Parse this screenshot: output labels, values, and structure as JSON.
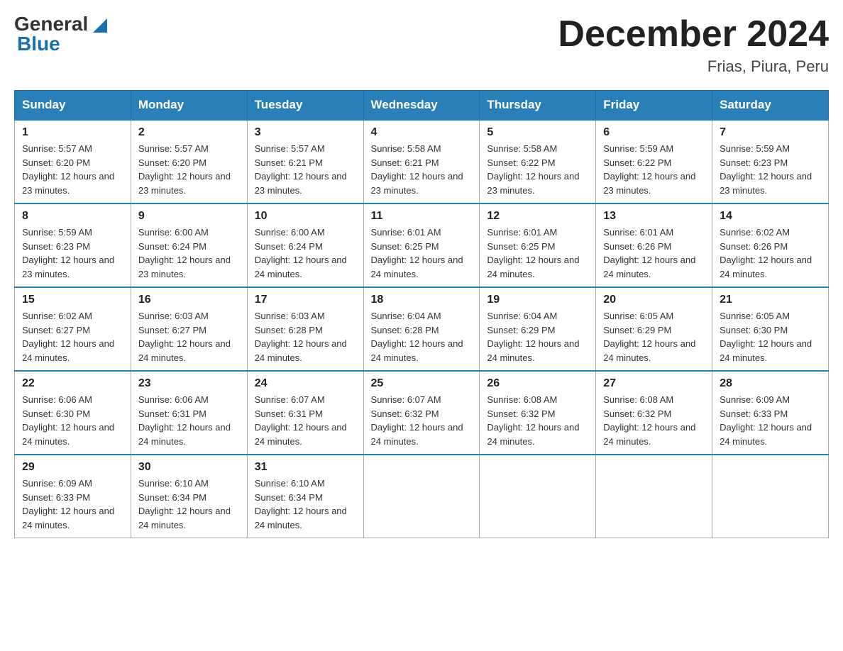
{
  "header": {
    "logo_general": "General",
    "logo_blue": "Blue",
    "month_title": "December 2024",
    "subtitle": "Frias, Piura, Peru"
  },
  "days_of_week": [
    "Sunday",
    "Monday",
    "Tuesday",
    "Wednesday",
    "Thursday",
    "Friday",
    "Saturday"
  ],
  "weeks": [
    [
      {
        "day": "1",
        "sunrise": "5:57 AM",
        "sunset": "6:20 PM",
        "daylight": "12 hours and 23 minutes."
      },
      {
        "day": "2",
        "sunrise": "5:57 AM",
        "sunset": "6:20 PM",
        "daylight": "12 hours and 23 minutes."
      },
      {
        "day": "3",
        "sunrise": "5:57 AM",
        "sunset": "6:21 PM",
        "daylight": "12 hours and 23 minutes."
      },
      {
        "day": "4",
        "sunrise": "5:58 AM",
        "sunset": "6:21 PM",
        "daylight": "12 hours and 23 minutes."
      },
      {
        "day": "5",
        "sunrise": "5:58 AM",
        "sunset": "6:22 PM",
        "daylight": "12 hours and 23 minutes."
      },
      {
        "day": "6",
        "sunrise": "5:59 AM",
        "sunset": "6:22 PM",
        "daylight": "12 hours and 23 minutes."
      },
      {
        "day": "7",
        "sunrise": "5:59 AM",
        "sunset": "6:23 PM",
        "daylight": "12 hours and 23 minutes."
      }
    ],
    [
      {
        "day": "8",
        "sunrise": "5:59 AM",
        "sunset": "6:23 PM",
        "daylight": "12 hours and 23 minutes."
      },
      {
        "day": "9",
        "sunrise": "6:00 AM",
        "sunset": "6:24 PM",
        "daylight": "12 hours and 23 minutes."
      },
      {
        "day": "10",
        "sunrise": "6:00 AM",
        "sunset": "6:24 PM",
        "daylight": "12 hours and 24 minutes."
      },
      {
        "day": "11",
        "sunrise": "6:01 AM",
        "sunset": "6:25 PM",
        "daylight": "12 hours and 24 minutes."
      },
      {
        "day": "12",
        "sunrise": "6:01 AM",
        "sunset": "6:25 PM",
        "daylight": "12 hours and 24 minutes."
      },
      {
        "day": "13",
        "sunrise": "6:01 AM",
        "sunset": "6:26 PM",
        "daylight": "12 hours and 24 minutes."
      },
      {
        "day": "14",
        "sunrise": "6:02 AM",
        "sunset": "6:26 PM",
        "daylight": "12 hours and 24 minutes."
      }
    ],
    [
      {
        "day": "15",
        "sunrise": "6:02 AM",
        "sunset": "6:27 PM",
        "daylight": "12 hours and 24 minutes."
      },
      {
        "day": "16",
        "sunrise": "6:03 AM",
        "sunset": "6:27 PM",
        "daylight": "12 hours and 24 minutes."
      },
      {
        "day": "17",
        "sunrise": "6:03 AM",
        "sunset": "6:28 PM",
        "daylight": "12 hours and 24 minutes."
      },
      {
        "day": "18",
        "sunrise": "6:04 AM",
        "sunset": "6:28 PM",
        "daylight": "12 hours and 24 minutes."
      },
      {
        "day": "19",
        "sunrise": "6:04 AM",
        "sunset": "6:29 PM",
        "daylight": "12 hours and 24 minutes."
      },
      {
        "day": "20",
        "sunrise": "6:05 AM",
        "sunset": "6:29 PM",
        "daylight": "12 hours and 24 minutes."
      },
      {
        "day": "21",
        "sunrise": "6:05 AM",
        "sunset": "6:30 PM",
        "daylight": "12 hours and 24 minutes."
      }
    ],
    [
      {
        "day": "22",
        "sunrise": "6:06 AM",
        "sunset": "6:30 PM",
        "daylight": "12 hours and 24 minutes."
      },
      {
        "day": "23",
        "sunrise": "6:06 AM",
        "sunset": "6:31 PM",
        "daylight": "12 hours and 24 minutes."
      },
      {
        "day": "24",
        "sunrise": "6:07 AM",
        "sunset": "6:31 PM",
        "daylight": "12 hours and 24 minutes."
      },
      {
        "day": "25",
        "sunrise": "6:07 AM",
        "sunset": "6:32 PM",
        "daylight": "12 hours and 24 minutes."
      },
      {
        "day": "26",
        "sunrise": "6:08 AM",
        "sunset": "6:32 PM",
        "daylight": "12 hours and 24 minutes."
      },
      {
        "day": "27",
        "sunrise": "6:08 AM",
        "sunset": "6:32 PM",
        "daylight": "12 hours and 24 minutes."
      },
      {
        "day": "28",
        "sunrise": "6:09 AM",
        "sunset": "6:33 PM",
        "daylight": "12 hours and 24 minutes."
      }
    ],
    [
      {
        "day": "29",
        "sunrise": "6:09 AM",
        "sunset": "6:33 PM",
        "daylight": "12 hours and 24 minutes."
      },
      {
        "day": "30",
        "sunrise": "6:10 AM",
        "sunset": "6:34 PM",
        "daylight": "12 hours and 24 minutes."
      },
      {
        "day": "31",
        "sunrise": "6:10 AM",
        "sunset": "6:34 PM",
        "daylight": "12 hours and 24 minutes."
      },
      null,
      null,
      null,
      null
    ]
  ],
  "labels": {
    "sunrise_prefix": "Sunrise: ",
    "sunset_prefix": "Sunset: ",
    "daylight_prefix": "Daylight: "
  }
}
